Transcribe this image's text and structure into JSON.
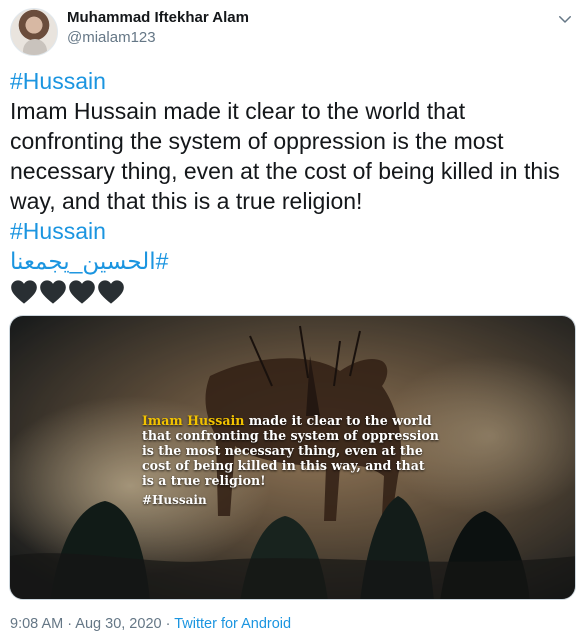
{
  "user": {
    "display_name": "Muhammad Iftekhar Alam",
    "handle": "@mialam123"
  },
  "tweet": {
    "lines": [
      "#Hussain",
      "Imam Hussain made it clear to the world that",
      "confronting the system of oppression is the most",
      "necessary thing, even at the cost of being killed in this",
      "way, and that this is a true religion!",
      "#Hussain",
      "#الحسين_يجمعنا"
    ],
    "hearts": "🖤🖤🖤🖤"
  },
  "media": {
    "highlight": "Imam Hussain",
    "line1_rest": " made it clear to the world",
    "line2": "that confronting the system of oppression",
    "line3": "is the most necessary thing, even at the",
    "line4": "cost of being killed in this way, and that",
    "line5": "is a true religion!",
    "hashtag": "#Hussain"
  },
  "footer": {
    "time": "9:08 AM",
    "date": "Aug 30, 2020",
    "source": "Twitter for Android"
  },
  "colors": {
    "link": "#1b95e0",
    "secondary_text": "#657786",
    "highlight_yellow": "#f2c200"
  }
}
